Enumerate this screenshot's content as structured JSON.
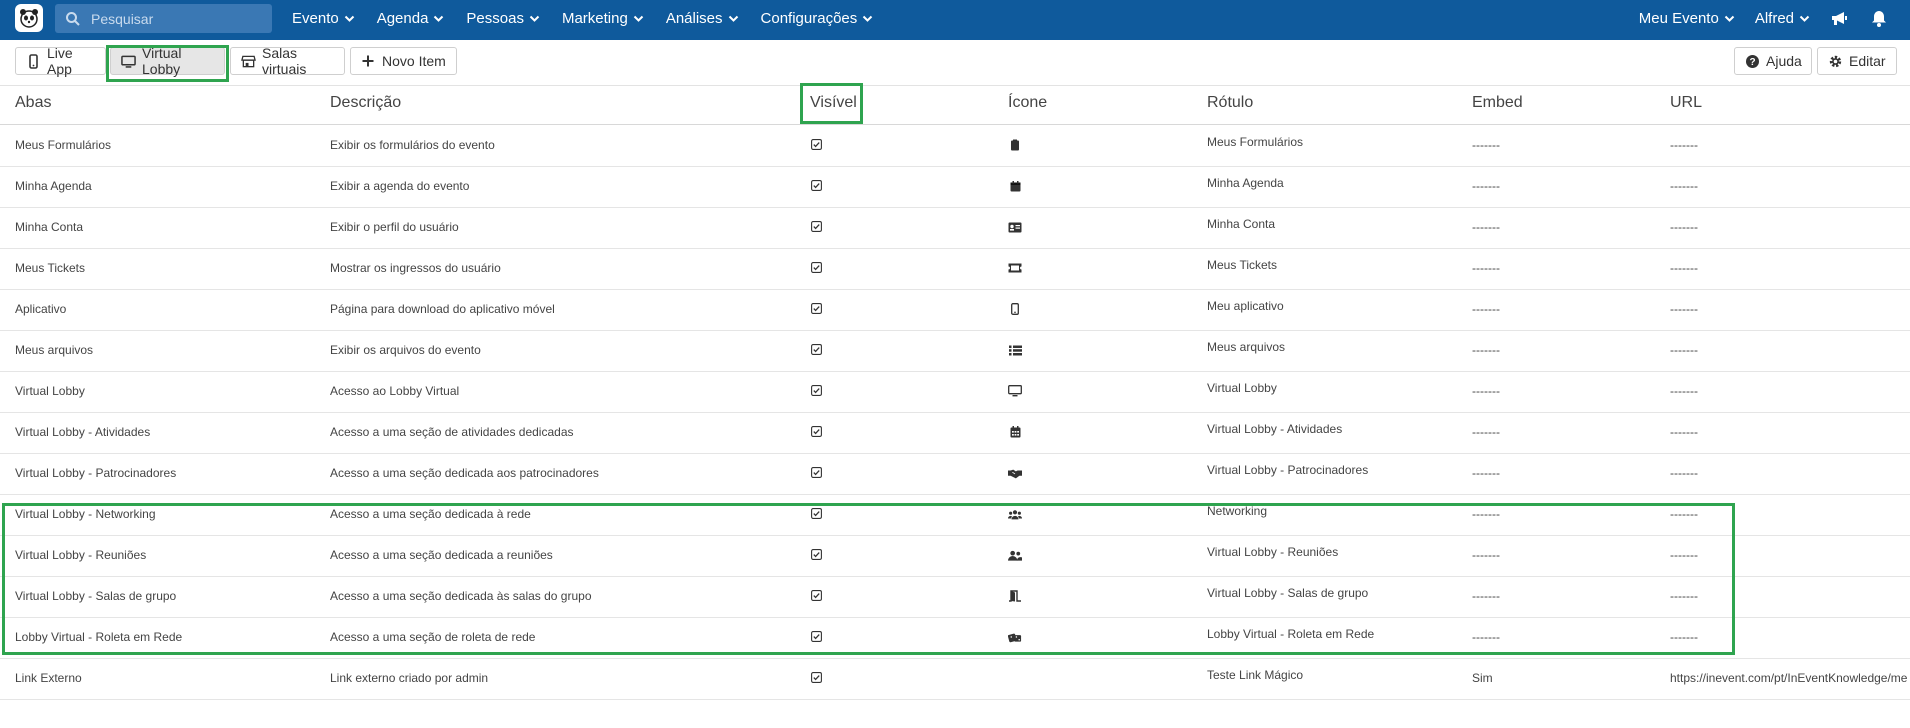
{
  "search": {
    "placeholder": "Pesquisar"
  },
  "nav": {
    "items": [
      "Evento",
      "Agenda",
      "Pessoas",
      "Marketing",
      "Análises",
      "Configurações"
    ],
    "right": [
      "Meu Evento",
      "Alfred"
    ]
  },
  "toolbar": {
    "live_app": "Live App",
    "virtual_lobby": "Virtual Lobby",
    "salas_virtuais": "Salas virtuais",
    "novo_item": "Novo Item",
    "ajuda": "Ajuda",
    "editar": "Editar"
  },
  "table": {
    "headers": {
      "abas": "Abas",
      "descricao": "Descrição",
      "visivel": "Visível",
      "icone": "Ícone",
      "rotulo": "Rótulo",
      "embed": "Embed",
      "url": "URL"
    },
    "rows": [
      {
        "aba": "Meus Formulários",
        "desc": "Exibir os formulários do evento",
        "icon": "clipboard-icon",
        "rotulo": "Meus Formulários",
        "embed": "-------",
        "url": "-------"
      },
      {
        "aba": "Minha Agenda",
        "desc": "Exibir a agenda do evento",
        "icon": "calendar-icon",
        "rotulo": "Minha Agenda",
        "embed": "-------",
        "url": "-------"
      },
      {
        "aba": "Minha Conta",
        "desc": "Exibir o perfil do usuário",
        "icon": "id-card-icon",
        "rotulo": "Minha Conta",
        "embed": "-------",
        "url": "-------"
      },
      {
        "aba": "Meus Tickets",
        "desc": "Mostrar os ingressos do usuário",
        "icon": "ticket-icon",
        "rotulo": "Meus Tickets",
        "embed": "-------",
        "url": "-------"
      },
      {
        "aba": "Aplicativo",
        "desc": "Página para download do aplicativo móvel",
        "icon": "mobile-icon",
        "rotulo": "Meu aplicativo",
        "embed": "-------",
        "url": "-------"
      },
      {
        "aba": "Meus arquivos",
        "desc": "Exibir os arquivos do evento",
        "icon": "list-icon",
        "rotulo": "Meus arquivos",
        "embed": "-------",
        "url": "-------"
      },
      {
        "aba": "Virtual Lobby",
        "desc": "Acesso ao Lobby Virtual",
        "icon": "monitor-icon",
        "rotulo": "Virtual Lobby",
        "embed": "-------",
        "url": "-------"
      },
      {
        "aba": "Virtual Lobby - Atividades",
        "desc": "Acesso a uma seção de atividades dedicadas",
        "icon": "calendar-grid-icon",
        "rotulo": "Virtual Lobby - Atividades",
        "embed": "-------",
        "url": "-------"
      },
      {
        "aba": "Virtual Lobby - Patrocinadores",
        "desc": "Acesso a uma seção dedicada aos patrocinadores",
        "icon": "handshake-icon",
        "rotulo": "Virtual Lobby - Patrocinadores",
        "embed": "-------",
        "url": "-------"
      },
      {
        "aba": "Virtual Lobby - Networking",
        "desc": "Acesso a uma seção dedicada à rede",
        "icon": "users-icon",
        "rotulo": "Networking",
        "embed": "-------",
        "url": "-------"
      },
      {
        "aba": "Virtual Lobby - Reuniões",
        "desc": "Acesso a uma seção dedicada a reuniões",
        "icon": "user-friends-icon",
        "rotulo": "Virtual Lobby - Reuniões",
        "embed": "-------",
        "url": "-------"
      },
      {
        "aba": "Virtual Lobby - Salas de grupo",
        "desc": "Acesso a uma seção dedicada às salas do grupo",
        "icon": "door-icon",
        "rotulo": "Virtual Lobby - Salas de grupo",
        "embed": "-------",
        "url": "-------"
      },
      {
        "aba": "Lobby Virtual - Roleta em Rede",
        "desc": "Acesso a uma seção de roleta de rede",
        "icon": "dice-icon",
        "rotulo": "Lobby Virtual - Roleta em Rede",
        "embed": "-------",
        "url": "-------"
      },
      {
        "aba": "Link Externo",
        "desc": "Link externo criado por admin",
        "icon": "",
        "rotulo": "Teste Link Mágico",
        "embed": "Sim",
        "url": "https://inevent.com/pt/InEventKnowledge/me"
      }
    ]
  },
  "colors": {
    "topbar": "#0f5a9c",
    "highlight": "#2fa44f"
  }
}
